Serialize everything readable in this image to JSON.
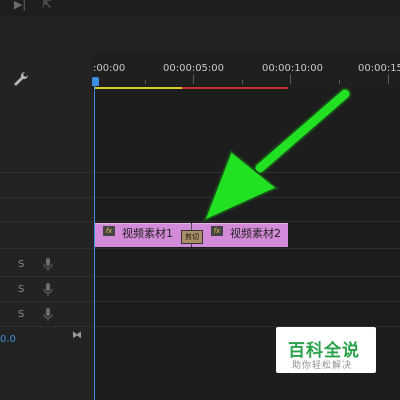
{
  "timeline": {
    "timecodes": [
      ":00:00",
      "00:00:05:00",
      "00:00:10:00",
      "00:00:15"
    ],
    "playhead_value": "0.0"
  },
  "clips": [
    {
      "label": "视频素材1"
    },
    {
      "label": "视频素材2"
    }
  ],
  "audio_tracks": [
    {
      "s_label": "S"
    },
    {
      "s_label": "S"
    },
    {
      "s_label": "S"
    }
  ],
  "cut_icon_text": "剪切",
  "fx_label": "fx",
  "watermark": {
    "title": "百科全说",
    "subtitle": "助你轻松解决"
  },
  "colors": {
    "accent": "#3e8fe0",
    "clip": "#d38ad8",
    "arrow": "#22e022",
    "work_area_yellow": "#d8cd2e",
    "work_area_red": "#c43030"
  }
}
